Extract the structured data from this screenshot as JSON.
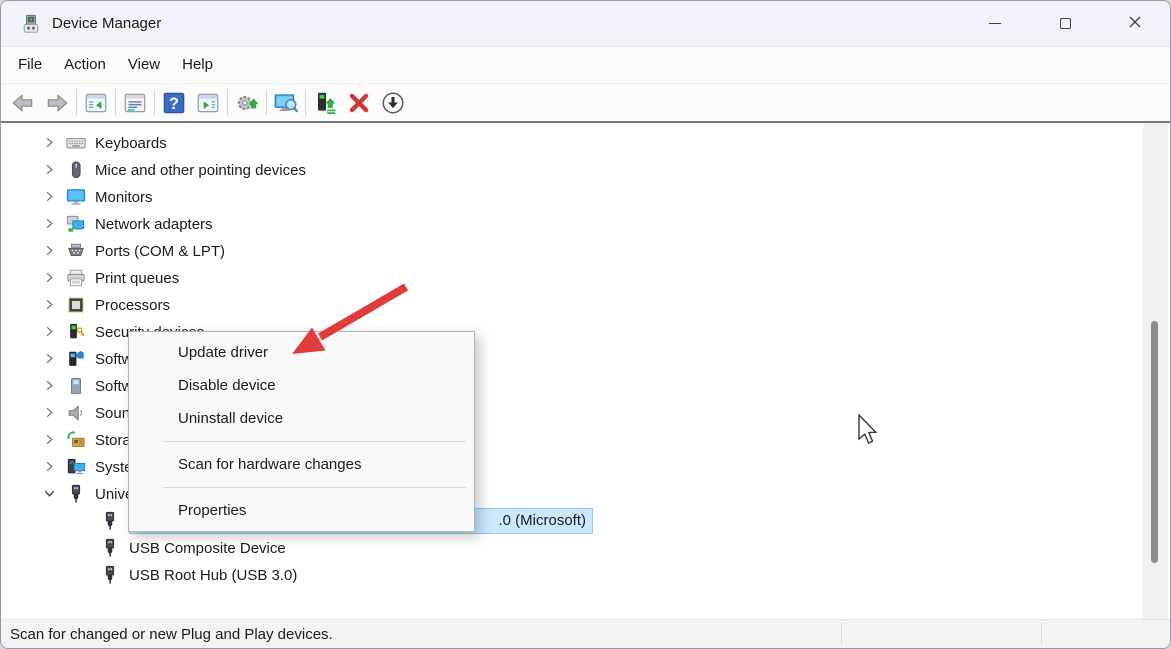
{
  "window": {
    "title": "Device Manager",
    "app_icon": "device-manager-icon"
  },
  "titlebar": {
    "controls": [
      "minimize-icon",
      "maximize-icon",
      "close-icon"
    ]
  },
  "menubar": {
    "items": [
      "File",
      "Action",
      "View",
      "Help"
    ]
  },
  "toolbar": {
    "items": [
      "back-icon",
      "forward-icon",
      "|",
      "show-hide-console-tree-icon",
      "|",
      "properties-icon",
      "|",
      "help-icon",
      "action-pane-icon",
      "|",
      "update-driver-software-icon",
      "|",
      "scan-hardware-changes-icon",
      "|",
      "update-driver-icon",
      "uninstall-device-icon",
      "disable-device-icon"
    ]
  },
  "tree": {
    "items": [
      {
        "level": 0,
        "chevron": "collapsed",
        "icon": "keyboard-icon",
        "label": "Keyboards"
      },
      {
        "level": 0,
        "chevron": "collapsed",
        "icon": "mouse-icon",
        "label": "Mice and other pointing devices"
      },
      {
        "level": 0,
        "chevron": "collapsed",
        "icon": "monitor-icon",
        "label": "Monitors"
      },
      {
        "level": 0,
        "chevron": "collapsed",
        "icon": "network-adapter-icon",
        "label": "Network adapters"
      },
      {
        "level": 0,
        "chevron": "collapsed",
        "icon": "serial-port-icon",
        "label": "Ports (COM & LPT)"
      },
      {
        "level": 0,
        "chevron": "collapsed",
        "icon": "printer-icon",
        "label": "Print queues"
      },
      {
        "level": 0,
        "chevron": "collapsed",
        "icon": "processor-icon",
        "label": "Processors"
      },
      {
        "level": 0,
        "chevron": "collapsed",
        "icon": "security-device-icon",
        "label": "Security devices"
      },
      {
        "level": 0,
        "chevron": "collapsed",
        "icon": "software-component-icon",
        "label": "Software components"
      },
      {
        "level": 0,
        "chevron": "collapsed",
        "icon": "software-device-icon",
        "label": "Software devices"
      },
      {
        "level": 0,
        "chevron": "collapsed",
        "icon": "sound-icon",
        "label": "Sound, video and game controllers"
      },
      {
        "level": 0,
        "chevron": "collapsed",
        "icon": "storage-controller-icon",
        "label": "Storage controllers"
      },
      {
        "level": 0,
        "chevron": "collapsed",
        "icon": "system-device-icon",
        "label": "System devices"
      },
      {
        "level": 0,
        "chevron": "expanded",
        "icon": "usb-icon",
        "label": "Universal Serial Bus controllers"
      },
      {
        "level": 1,
        "chevron": "none",
        "icon": "usb-icon",
        "visible_label": ".0 (Microsoft)",
        "selected": true
      },
      {
        "level": 1,
        "chevron": "none",
        "icon": "usb-icon",
        "label": "USB Composite Device"
      },
      {
        "level": 1,
        "chevron": "none",
        "icon": "usb-icon",
        "label": "USB Root Hub (USB 3.0)"
      }
    ]
  },
  "context_menu": {
    "items": [
      "Update driver",
      "Disable device",
      "Uninstall device",
      "|",
      "Scan for hardware changes",
      "|",
      "Properties"
    ]
  },
  "statusbar": {
    "text": "Scan for changed or new Plug and Play devices."
  },
  "annotations": {
    "red_arrow_target": "Update driver"
  },
  "colors": {
    "titlebar_bg": "#eff4fa",
    "selection_bg": "#cce8ff",
    "selection_border": "#8ec9f2",
    "arrow_red": "#e03c3c"
  }
}
